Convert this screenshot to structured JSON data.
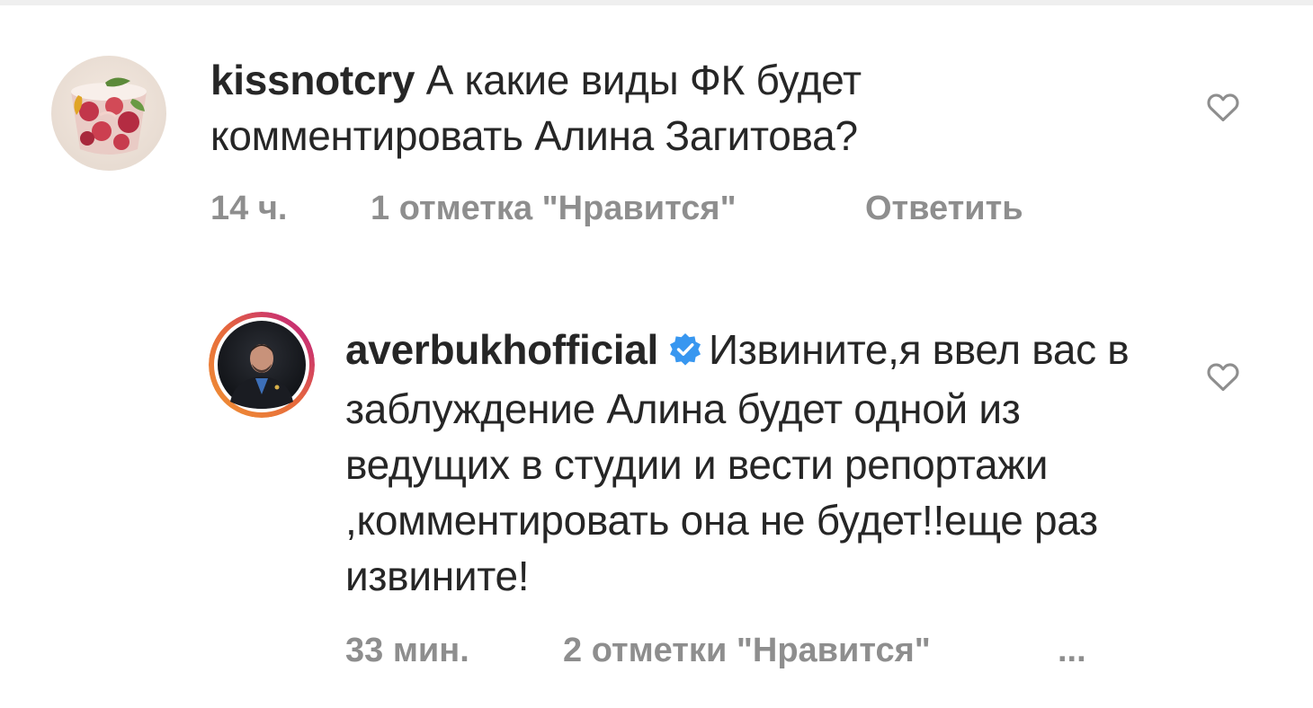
{
  "comments": [
    {
      "username": "kissnotcry",
      "text": "А какие виды ФК будет комментировать Алина Загитова?",
      "time": "14 ч.",
      "likes": "1 отметка \"Нравится\"",
      "reply": "Ответить",
      "like_icon": "heart-outline-icon"
    },
    {
      "username": "averbukhofficial",
      "verified": true,
      "text_line1": "Извините,я ввел",
      "text_rest": "вас в заблуждение Алина будет одной из ведущих в студии и вести репортажи ,комментировать она не будет!!еще раз извините!",
      "time": "33 мин.",
      "likes": "2 отметки \"Нравится\"",
      "more": "...",
      "like_icon": "heart-outline-icon"
    }
  ],
  "colors": {
    "text": "#262626",
    "meta": "#8e8e8e",
    "verified_badge": "#3897f0",
    "story_ring_start": "#f09433",
    "story_ring_end": "#bc1888"
  }
}
